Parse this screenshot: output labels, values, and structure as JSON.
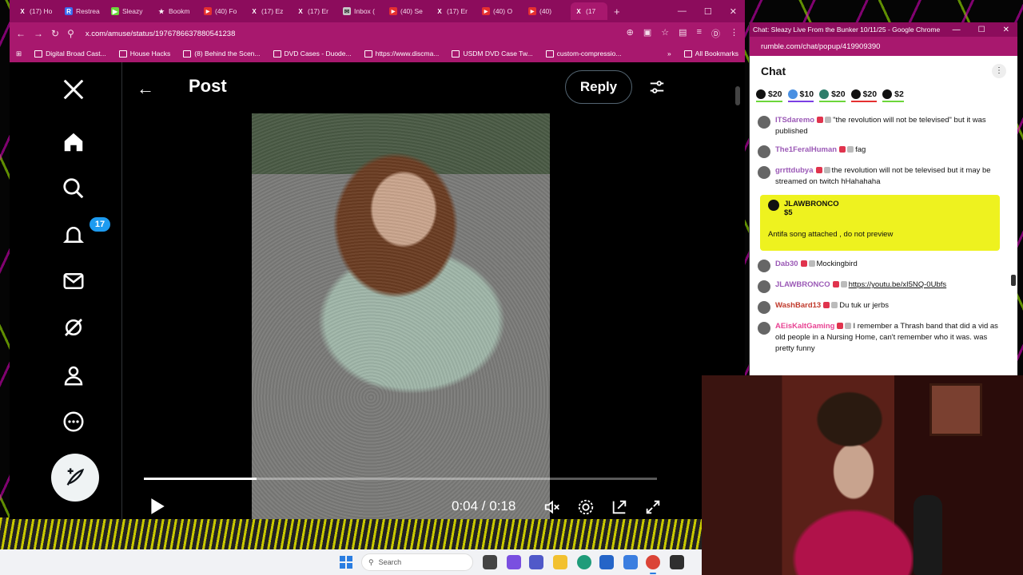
{
  "browser": {
    "tabs": [
      {
        "label": "(17) Ho",
        "icon": "x-icon"
      },
      {
        "label": "Restrea",
        "icon": "restream-icon"
      },
      {
        "label": "Sleazy",
        "icon": "rumble-icon"
      },
      {
        "label": "Bookm",
        "icon": "star-icon"
      },
      {
        "label": "(40) Fo",
        "icon": "youtube-icon"
      },
      {
        "label": "(17) Ez",
        "icon": "x-icon"
      },
      {
        "label": "(17) Er",
        "icon": "x-icon"
      },
      {
        "label": "Inbox (",
        "icon": "mail-icon"
      },
      {
        "label": "(40) Se",
        "icon": "youtube-icon"
      },
      {
        "label": "(17) Er",
        "icon": "x-icon"
      },
      {
        "label": "(40) O",
        "icon": "youtube-icon"
      },
      {
        "label": "(40)",
        "icon": "youtube-icon"
      },
      {
        "label": "(17",
        "icon": "x-icon"
      }
    ],
    "url": "x.com/amuse/status/1976786637880541238",
    "bookmarks": [
      "Digital Broad Cast...",
      "House Hacks",
      "(8) Behind the Scen...",
      "DVD Cases - Duode...",
      "https://www.discma...",
      "USDM DVD Case Tw...",
      "custom-compressio..."
    ],
    "all_bookmarks": "All Bookmarks"
  },
  "x": {
    "header_title": "Post",
    "reply_label": "Reply",
    "notification_count": "17",
    "video": {
      "time": "0:04 / 0:18",
      "progress": 0.22
    }
  },
  "chat_window": {
    "title": "Chat: Sleazy Live From the Bunker 10/11/25 - Google Chrome",
    "url": "rumble.com/chat/popup/419909390",
    "header": "Chat",
    "rants": [
      "$20",
      "$10",
      "$20",
      "$20",
      "$2"
    ],
    "messages": [
      {
        "user": "ITSdaremo",
        "color": "#9b59b6",
        "text": "\"the revolution will not be televised\" but it was published"
      },
      {
        "user": "The1FeralHuman",
        "color": "#9b59b6",
        "text": "fag"
      },
      {
        "user": "grrttdubya",
        "color": "#9b59b6",
        "text": "the revolution will not be televised but it may be streamed on twitch hHahahaha"
      }
    ],
    "rant_card": {
      "user": "JLAWBRONCO",
      "amount": "$5",
      "text": "Antifa song attached , do not preview"
    },
    "messages2": [
      {
        "user": "Dab30",
        "color": "#9b59b6",
        "text": "Mockingbird"
      },
      {
        "user": "JLAWBRONCO",
        "color": "#9b59b6",
        "text": "https://youtu.be/xI5NQ-0Ubfs"
      },
      {
        "user": "WashBard13",
        "color": "#c0392b",
        "text": "Du tuk ur jerbs"
      },
      {
        "user": "AEisKaltGaming",
        "color": "#e84393",
        "text": "I remember a Thrash band that did a vid as old people in a Nursing Home, can't remember who it was. was pretty funny"
      }
    ]
  },
  "taskbar": {
    "search_placeholder": "Search"
  }
}
